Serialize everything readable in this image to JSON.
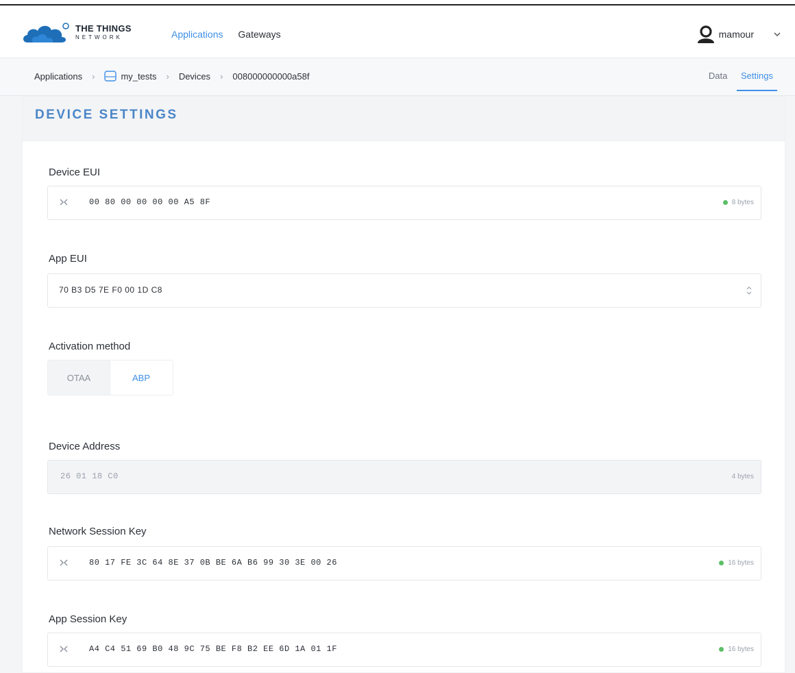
{
  "header": {
    "brand_top": "THE THINGS",
    "brand_bottom": "NETWORK",
    "nav": {
      "applications": "Applications",
      "gateways": "Gateways"
    },
    "user": {
      "name": "mamour",
      "icon": "user-avatar-icon"
    }
  },
  "breadcrumb": {
    "items": [
      "Applications",
      "my_tests",
      "Devices",
      "008000000000a58f"
    ],
    "separator": "›"
  },
  "tabs": {
    "data": "Data",
    "settings": "Settings"
  },
  "card": {
    "title": "DEVICE SETTINGS"
  },
  "fields": {
    "device_eui": {
      "label": "Device EUI",
      "value": "00 80 00 00 00 00 A5 8F",
      "bytes": "8 bytes"
    },
    "app_eui": {
      "label": "App EUI",
      "value": "70 B3 D5 7E F0 00 1D C8"
    },
    "activation": {
      "label": "Activation method",
      "options": [
        "OTAA",
        "ABP"
      ],
      "selected": "ABP"
    },
    "device_address": {
      "label": "Device Address",
      "value": "26 01 18 C0",
      "bytes": "4 bytes"
    },
    "nwk_skey": {
      "label": "Network Session Key",
      "value": "80 17 FE 3C 64 8E 37 0B BE 6A B6 99 30 3E 00 26",
      "bytes": "16 bytes"
    },
    "app_skey": {
      "label": "App Session Key",
      "value": "A4 C4 51 69 B0 48 9C 75 BE F8 B2 EE 6D 1A 01 1F",
      "bytes": "16 bytes"
    }
  },
  "colors": {
    "accent": "#3f8fe6",
    "title": "#4a86c8",
    "ok": "#5bbf66"
  }
}
